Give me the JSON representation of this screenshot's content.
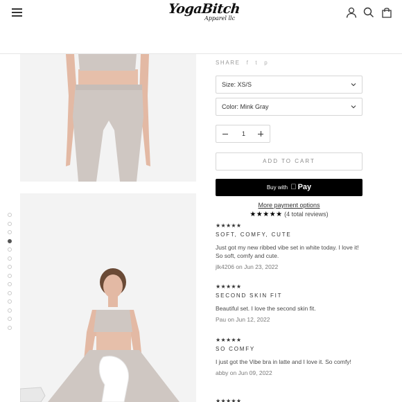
{
  "header": {
    "logo_main": "YogaBitch",
    "logo_sub": "Apparel llc",
    "icons": [
      "menu-icon",
      "account-icon",
      "search-icon",
      "cart-icon"
    ]
  },
  "product": {
    "share_label": "SHARE",
    "share_icons": [
      "f",
      "t",
      "p"
    ],
    "size_select": "Size: XS/S",
    "color_select": "Color: Mink Gray",
    "quantity": "1",
    "add_to_cart": "ADD TO CART",
    "buy_with": "Buy with",
    "apple_pay": "Pay",
    "more_payment": "More payment options"
  },
  "reviews_summary": {
    "stars": "★★★★★",
    "count_text": "(4 total reviews)"
  },
  "reviews": [
    {
      "stars": "★★★★★",
      "title": "SOFT, COMFY, CUTE",
      "body": "Just got my new ribbed vibe set in white today. I love it! So soft, comfy and cute.",
      "meta": "jlk4206 on Jun 23, 2022"
    },
    {
      "stars": "★★★★★",
      "title": "SECOND SKIN FIT",
      "body": "Beautiful set. I love the second skin fit.",
      "meta": "Pau on Jun 12, 2022"
    },
    {
      "stars": "★★★★★",
      "title": "SO COMFY",
      "body": "I just got the Vibe bra in latte and I love it. So comfy!",
      "meta": "abby on Jun 09, 2022"
    },
    {
      "stars": "★★★★★"
    }
  ],
  "gallery": {
    "dot_count": 14,
    "active_dot": 4
  },
  "colors": {
    "product": "#cfc7c2",
    "apple_pay_bg": "#000000"
  }
}
